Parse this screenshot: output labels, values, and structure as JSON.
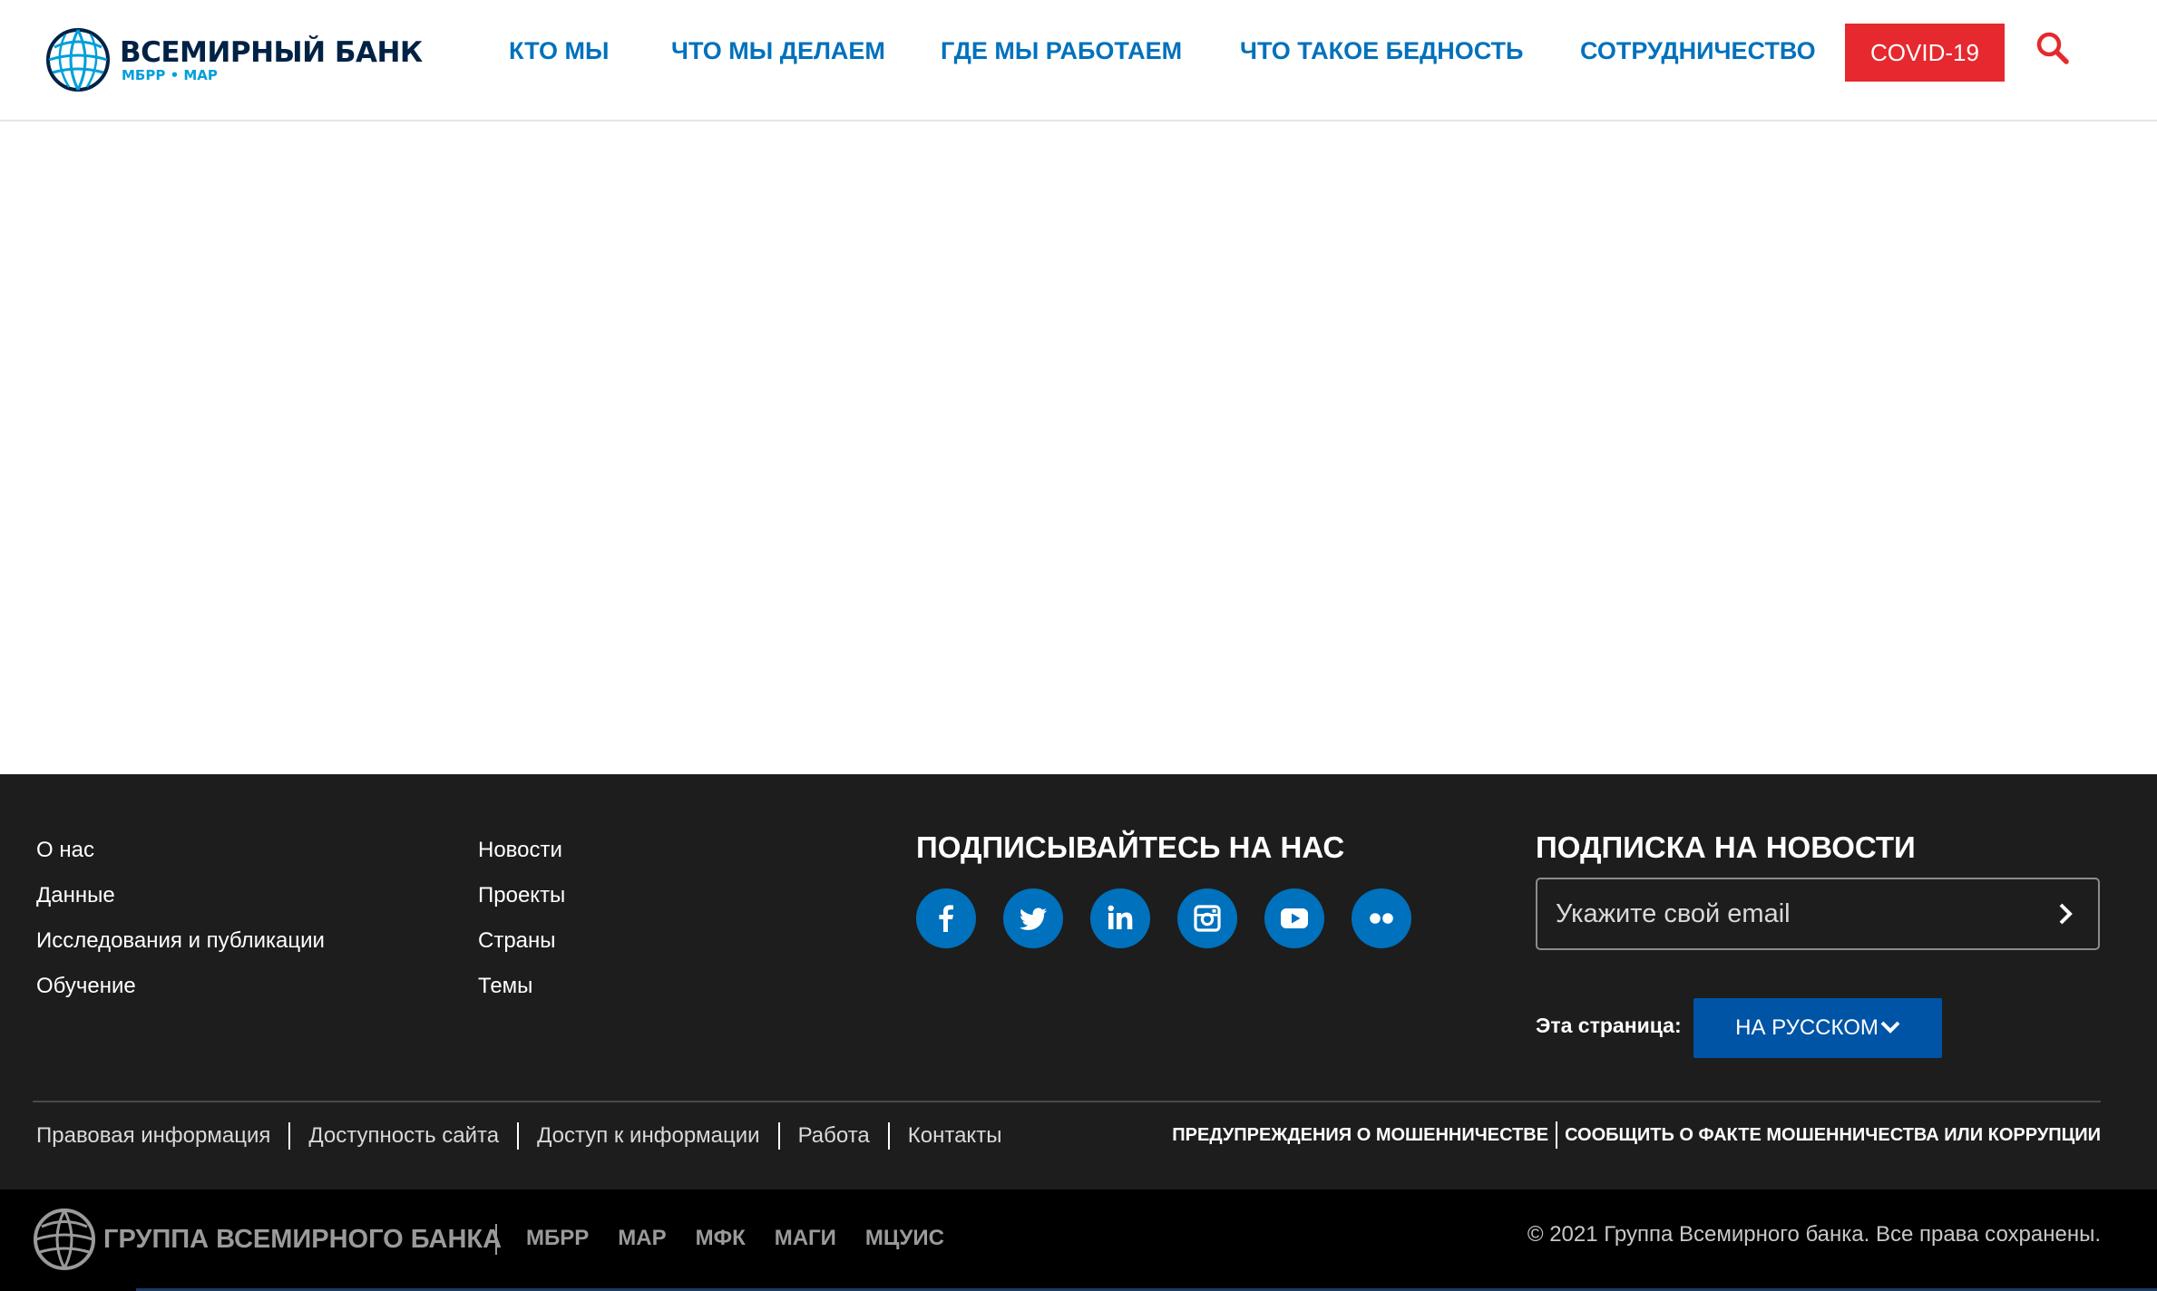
{
  "header": {
    "logo": {
      "name": "ВСЕМИРНЫЙ БАНК",
      "subtitle": "МБРР • МАР"
    },
    "nav": [
      {
        "label": "КТО МЫ"
      },
      {
        "label": "ЧТО МЫ ДЕЛАЕМ"
      },
      {
        "label": "ГДЕ МЫ РАБОТАЕМ"
      },
      {
        "label": "ЧТО ТАКОЕ БЕДНОСТЬ"
      },
      {
        "label": "СОТРУДНИЧЕСТВО"
      }
    ],
    "covid_label": "COVID-19",
    "search_icon": "search-icon",
    "colors": {
      "nav": "#0071bc",
      "covid": "#e5292e",
      "search": "#e5292e"
    }
  },
  "footer": {
    "col1": [
      "О нас",
      "Данные",
      "Исследования и публикации",
      "Обучение"
    ],
    "col2": [
      "Новости",
      "Проекты",
      "Страны",
      "Темы"
    ],
    "follow_heading": "ПОДПИСЫВАЙТЕСЬ НА НАС",
    "social": [
      {
        "icon": "facebook-icon"
      },
      {
        "icon": "twitter-icon"
      },
      {
        "icon": "linkedin-icon"
      },
      {
        "icon": "instagram-icon"
      },
      {
        "icon": "youtube-icon"
      },
      {
        "icon": "flickr-icon"
      }
    ],
    "newsletter_heading": "ПОДПИСКА НА НОВОСТИ",
    "email_placeholder": "Укажите свой email",
    "email_value": "",
    "lang_label": "Эта страница:",
    "lang_button": "НА РУССКОМ",
    "legal_links": [
      "Правовая информация",
      "Доступность сайта",
      "Доступ к информации",
      "Работа",
      "Контакты"
    ],
    "fraud_links": [
      "ПРЕДУПРЕЖДЕНИЯ О МОШЕННИЧЕСТВЕ",
      "СООБЩИТЬ О ФАКТЕ МОШЕННИЧЕСТВА ИЛИ КОРРУПЦИИ"
    ],
    "colors": {
      "background": "#1d1d1d",
      "social": "#0071bc",
      "lang_button": "#0054a6"
    }
  },
  "bottom_bar": {
    "group_name": "ГРУППА ВСЕМИРНОГО БАНКА",
    "members": [
      "МБРР",
      "МАР",
      "МФК",
      "МАГИ",
      "МЦУИС"
    ],
    "copyright": "© 2021 Группа Всемирного банка. Все права сохранены."
  }
}
